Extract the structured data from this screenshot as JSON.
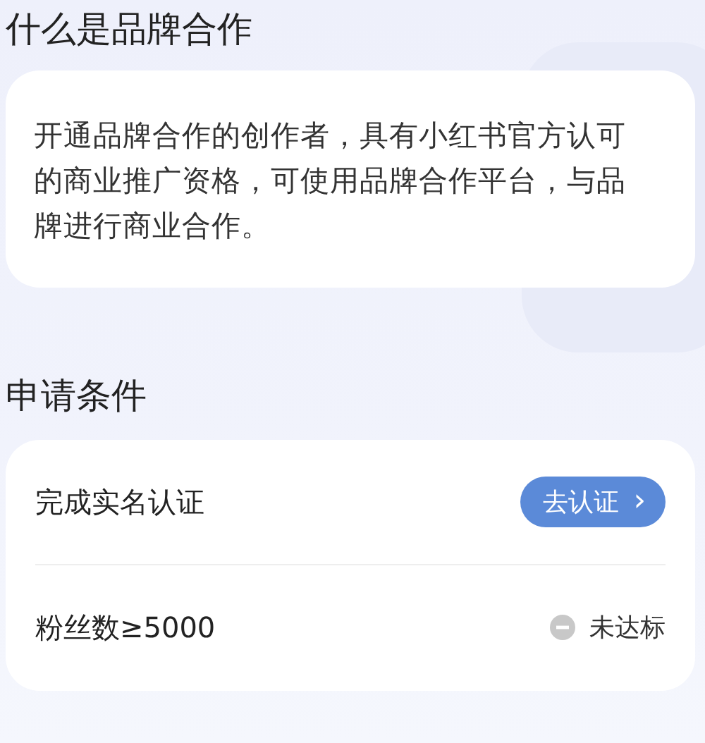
{
  "intro": {
    "title": "什么是品牌合作",
    "text": "开通品牌合作的创作者，具有小红书官方认可的商业推广资格，可使用品牌合作平台，与品牌进行商业合作。"
  },
  "conditions": {
    "title": "申请条件",
    "items": [
      {
        "kind": "action",
        "label": "完成实名认证",
        "action": "去认证",
        "chevron": "›"
      },
      {
        "kind": "status",
        "label": "粉丝数≥5000",
        "status": "未达标"
      }
    ]
  }
}
